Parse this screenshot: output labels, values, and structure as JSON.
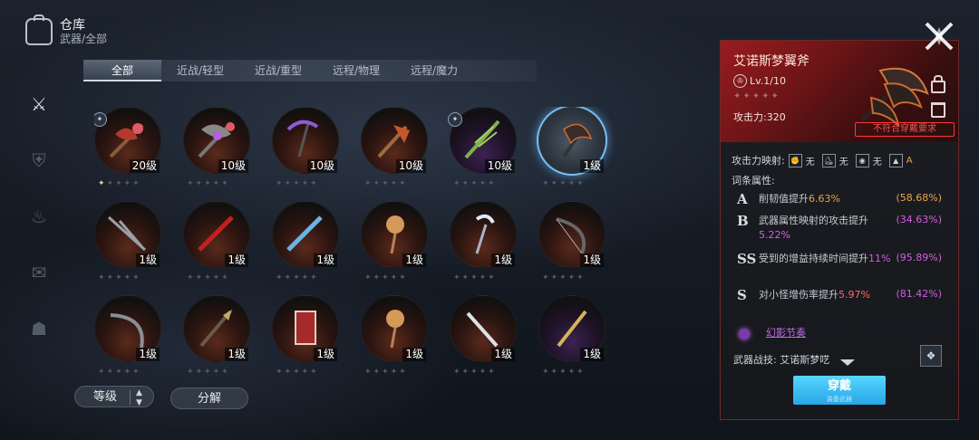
{
  "header": {
    "title": "仓库",
    "subtitle": "武器/全部"
  },
  "rail": [
    "weapon-icon",
    "armor-icon",
    "fire-icon",
    "scroll-icon",
    "hand-icon"
  ],
  "tabs": [
    {
      "label": "全部",
      "active": true
    },
    {
      "label": "近战/轻型"
    },
    {
      "label": "近战/重型"
    },
    {
      "label": "远程/物理"
    },
    {
      "label": "远程/魔力"
    }
  ],
  "items": [
    {
      "name": "axe-red",
      "level": "20级",
      "tint": "red",
      "badge": true,
      "stars_lit": 1
    },
    {
      "name": "battle-axe-gem",
      "level": "10级",
      "tint": "red",
      "badge": false,
      "stars_lit": 0
    },
    {
      "name": "scythe-purple",
      "level": "10级",
      "tint": "red",
      "badge": false,
      "stars_lit": 0
    },
    {
      "name": "bronze-halberd",
      "level": "10级",
      "tint": "red",
      "badge": false,
      "stars_lit": 0
    },
    {
      "name": "green-leaf-sword",
      "level": "10级",
      "tint": "purple",
      "badge": true,
      "stars_lit": 0
    },
    {
      "name": "dream-wing-axe",
      "level": "1级",
      "tint": "selected",
      "badge": false,
      "stars_lit": 0
    },
    {
      "name": "twin-blade",
      "level": "1级",
      "tint": "red",
      "badge": false,
      "stars_lit": 0
    },
    {
      "name": "red-blade",
      "level": "1级",
      "tint": "red",
      "badge": false,
      "stars_lit": 0
    },
    {
      "name": "blue-blade",
      "level": "1级",
      "tint": "red",
      "badge": false,
      "stars_lit": 0
    },
    {
      "name": "sun-staff",
      "level": "1级",
      "tint": "red",
      "badge": false,
      "stars_lit": 0
    },
    {
      "name": "moon-staff",
      "level": "1级",
      "tint": "red",
      "badge": false,
      "stars_lit": 0
    },
    {
      "name": "dark-bow",
      "level": "1级",
      "tint": "red",
      "badge": false,
      "stars_lit": 0
    },
    {
      "name": "curved-bow",
      "level": "1级",
      "tint": "red",
      "badge": false,
      "stars_lit": 0
    },
    {
      "name": "thorn-spear",
      "level": "1级",
      "tint": "red",
      "badge": false,
      "stars_lit": 0
    },
    {
      "name": "red-tome",
      "level": "1级",
      "tint": "red",
      "badge": false,
      "stars_lit": 0
    },
    {
      "name": "sun-staff-2",
      "level": "1级",
      "tint": "red",
      "badge": false,
      "stars_lit": 0
    },
    {
      "name": "steel-sword",
      "level": "1级",
      "tint": "red",
      "badge": false,
      "stars_lit": 0
    },
    {
      "name": "golden-spear",
      "level": "1级",
      "tint": "purple",
      "badge": false,
      "stars_lit": 0
    }
  ],
  "buttons": {
    "sort": "等级",
    "break": "分解"
  },
  "detail": {
    "name": "艾诺斯梦翼斧",
    "level": "Lv.1/10",
    "attack": "攻击力:320",
    "warning": "不符合穿戴要求",
    "mapping_label": "攻击力映射:",
    "mapping": [
      {
        "icon": "fist-icon",
        "value": "无"
      },
      {
        "icon": "boot-icon",
        "value": "无"
      },
      {
        "icon": "brain-icon",
        "value": "无"
      },
      {
        "icon": "mountain-icon",
        "value": "A"
      }
    ],
    "affix_title": "词条属性:",
    "affixes": [
      {
        "grade": "A",
        "text": "削韧值提升",
        "value": "6.63%",
        "value_color": "orange",
        "pct": "(58.68%)",
        "pct_color": "orange"
      },
      {
        "grade": "B",
        "text": "武器属性映射的攻击提升",
        "value": "5.22%",
        "value_color": "purple",
        "pct": "(34.63%)",
        "pct_color": "purple"
      },
      {
        "grade": "SS",
        "text": "受到的增益持续时间提升",
        "value": "11%",
        "value_color": "purple",
        "pct": "(95.89%)",
        "pct_color": "purple"
      },
      {
        "grade": "S",
        "text": "对小怪增伤率提升",
        "value": "5.97%",
        "value_color": "red",
        "pct": "(81.42%)",
        "pct_color": "purple"
      }
    ],
    "phantom": "幻影节奏",
    "skill_label": "武器战技: 艾诺斯梦呓",
    "equip": "穿戴",
    "equip_sub": "装备武器"
  },
  "colors": {
    "accent": "#27a6e6",
    "panel_red": "#9a1b1f",
    "warn": "#ff5050"
  }
}
